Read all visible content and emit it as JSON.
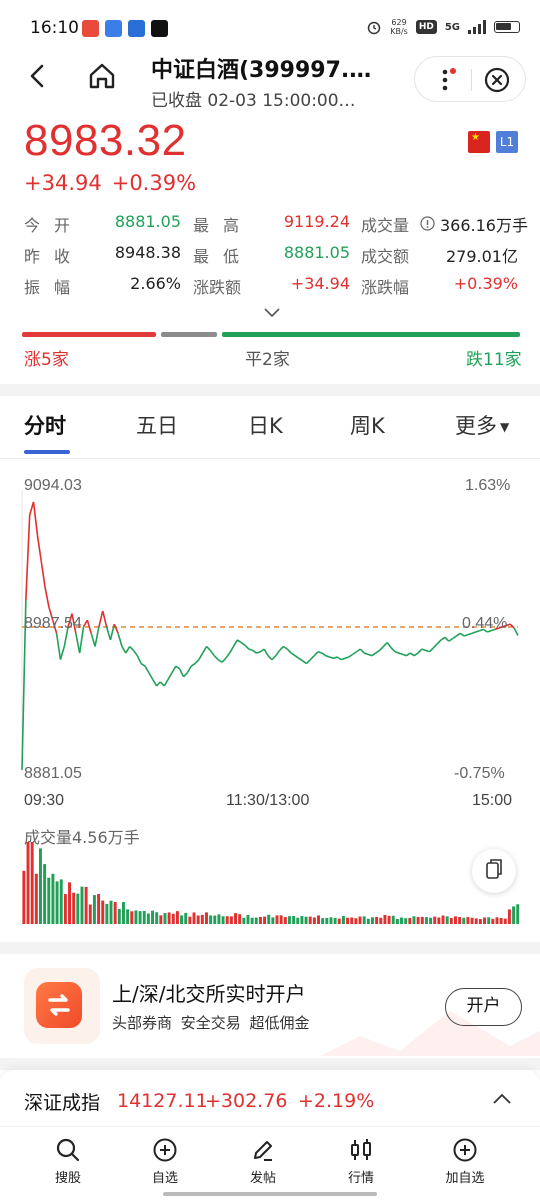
{
  "status_bar": {
    "time": "16:10",
    "network_speed": "629",
    "network_unit": "KB/s",
    "hd_badge": "HD",
    "signal": "5G"
  },
  "header": {
    "title": "中证白酒(399997.…",
    "subtitle": "已收盘 02-03 15:00:00…"
  },
  "quote": {
    "price": "8983.32",
    "change": "+34.94",
    "change_pct": "+0.39%",
    "level_badge": "L1"
  },
  "stats": {
    "open_label": "今开",
    "open": "8881.05",
    "high_label": "最高",
    "high": "9119.24",
    "volume_label": "成交量",
    "volume": "366.16万手",
    "prev_close_label": "昨收",
    "prev_close": "8948.38",
    "low_label": "最低",
    "low": "8881.05",
    "amount_label": "成交额",
    "amount": "279.01亿",
    "amplitude_label": "振幅",
    "amplitude": "2.66%",
    "change_amt_label": "涨跌额",
    "change_amt": "+34.94",
    "change_pct_label": "涨跌幅",
    "change_pct": "+0.39%"
  },
  "breadth": {
    "up_label": "涨5家",
    "flat_label": "平2家",
    "down_label": "跌11家"
  },
  "tabs": [
    {
      "label": "分时"
    },
    {
      "label": "五日"
    },
    {
      "label": "日K"
    },
    {
      "label": "周K"
    },
    {
      "label": "更多"
    }
  ],
  "chart_data": {
    "type": "line",
    "y_top_label": "9094.03",
    "y_mid_label": "8987.54",
    "y_bottom_label": "8881.05",
    "pct_top_label": "1.63%",
    "pct_mid_label": "0.44%",
    "pct_bottom_label": "-0.75%",
    "x_labels": [
      "09:30",
      "11:30/13:00",
      "15:00"
    ],
    "ylim": [
      8881.05,
      9094.03
    ],
    "reference": 8987.54,
    "volume_label": "成交量4.56万手",
    "series": [
      {
        "values": [
          8881.05,
          9010,
          9075,
          9085,
          9060,
          9040,
          9020,
          9005,
          8995,
          8985,
          8965,
          8975,
          8990,
          9000,
          8985,
          8970,
          8990,
          8995,
          8985,
          8975,
          8990,
          9002,
          8990,
          8980,
          8992,
          8985,
          8975,
          8970,
          8975,
          8972,
          8968,
          8962,
          8960,
          8955,
          8950,
          8945,
          8948,
          8945,
          8950,
          8955,
          8960,
          8958,
          8952,
          8955,
          8960,
          8962,
          8965,
          8970,
          8975,
          8972,
          8968,
          8965,
          8963,
          8966,
          8970,
          8975,
          8980,
          8978,
          8976,
          8973,
          8972,
          8970,
          8971,
          8973,
          8968,
          8965,
          8968,
          8972,
          8975,
          8973,
          8970,
          8968,
          8966,
          8964,
          8962,
          8965,
          8968,
          8971,
          8970,
          8968,
          8967,
          8966,
          8967,
          8965,
          8966,
          8967,
          8969,
          8971,
          8973,
          8970,
          8969,
          8968,
          8970,
          8972,
          8975,
          8978,
          8974,
          8971,
          8970,
          8969,
          8968,
          8970,
          8968,
          8970,
          8973,
          8972,
          8971,
          8974,
          8977,
          8980,
          8982,
          8979,
          8981,
          8983,
          8985,
          8983,
          8984,
          8985,
          8986,
          8987,
          8988,
          8986,
          8987,
          8988,
          8989,
          8990,
          8991,
          8992,
          8989,
          8983.32
        ]
      }
    ]
  },
  "promo": {
    "title": "上/深/北交所实时开户",
    "subtitle": "头部券商 安全交易 超低佣金",
    "button": "开户"
  },
  "ticker": {
    "name": "深证成指",
    "value": "14127.11",
    "change": "+302.76",
    "change_pct": "+2.19%"
  },
  "nav": [
    {
      "label": "搜股",
      "icon": "search-icon"
    },
    {
      "label": "自选",
      "icon": "plus-circle-icon"
    },
    {
      "label": "发帖",
      "icon": "pen-icon"
    },
    {
      "label": "行情",
      "icon": "candlestick-icon"
    },
    {
      "label": "加自选",
      "icon": "add-circle-icon"
    }
  ],
  "colors": {
    "up": "#e03030",
    "down": "#22a05a",
    "accent": "#3a63d6"
  }
}
